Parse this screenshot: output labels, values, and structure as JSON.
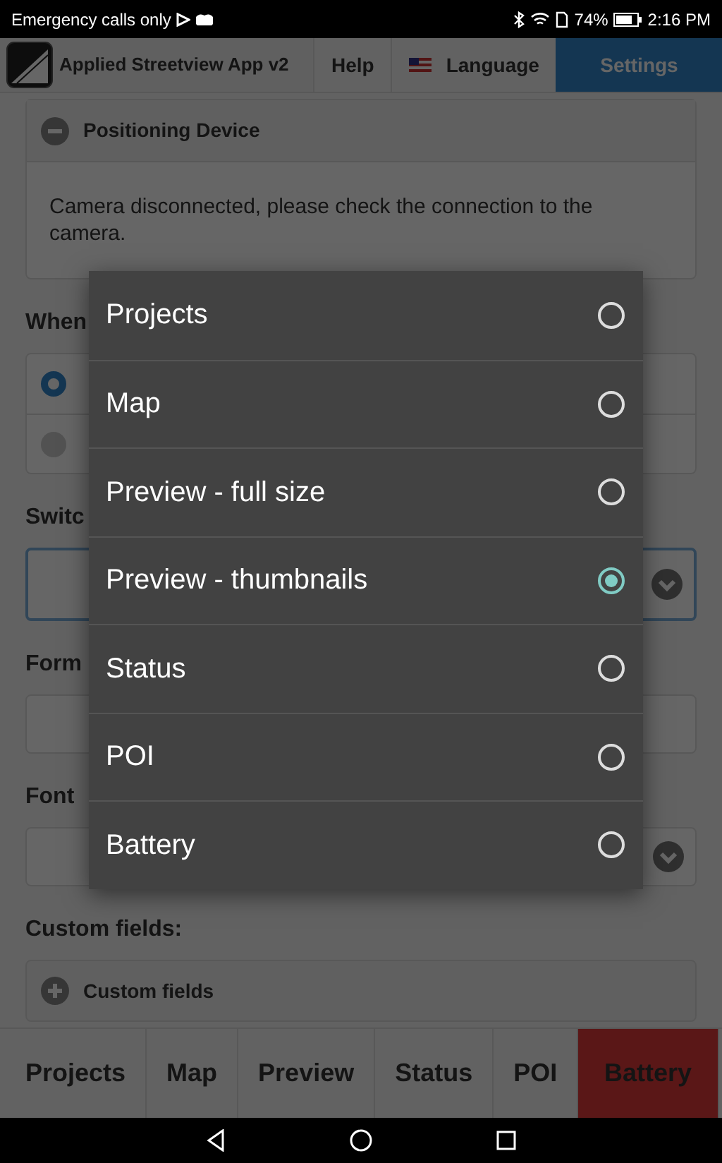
{
  "status_bar": {
    "carrier": "Emergency calls only",
    "battery": "74%",
    "time": "2:16 PM"
  },
  "header": {
    "title": "Applied Streetview App v2",
    "nav": [
      {
        "label": "Help",
        "selected": false,
        "kind": "plain"
      },
      {
        "label": "Language",
        "selected": false,
        "kind": "flag"
      },
      {
        "label": "Settings",
        "selected": true,
        "kind": "plain"
      }
    ]
  },
  "positioning": {
    "title": "Positioning Device",
    "expanded": true,
    "message": "Camera disconnected, please check the connection to the camera."
  },
  "when": {
    "label": "When",
    "options": [
      {
        "selected": true
      },
      {
        "selected": false
      }
    ]
  },
  "switch": {
    "label": "Switc",
    "focused": true
  },
  "format": {
    "label": "Form"
  },
  "font_size": {
    "label": "Font"
  },
  "custom": {
    "label": "Custom fields:",
    "panel_title": "Custom fields",
    "expanded": false
  },
  "dialog": {
    "options": [
      {
        "label": "Projects",
        "selected": false
      },
      {
        "label": "Map",
        "selected": false
      },
      {
        "label": "Preview - full size",
        "selected": false
      },
      {
        "label": "Preview - thumbnails",
        "selected": true
      },
      {
        "label": "Status",
        "selected": false
      },
      {
        "label": "POI",
        "selected": false
      },
      {
        "label": "Battery",
        "selected": false
      }
    ]
  },
  "bottom_tabs": [
    {
      "label": "Projects",
      "alert": false
    },
    {
      "label": "Map",
      "alert": false
    },
    {
      "label": "Preview",
      "alert": false
    },
    {
      "label": "Status",
      "alert": false
    },
    {
      "label": "POI",
      "alert": false
    },
    {
      "label": "Battery",
      "alert": true
    }
  ]
}
